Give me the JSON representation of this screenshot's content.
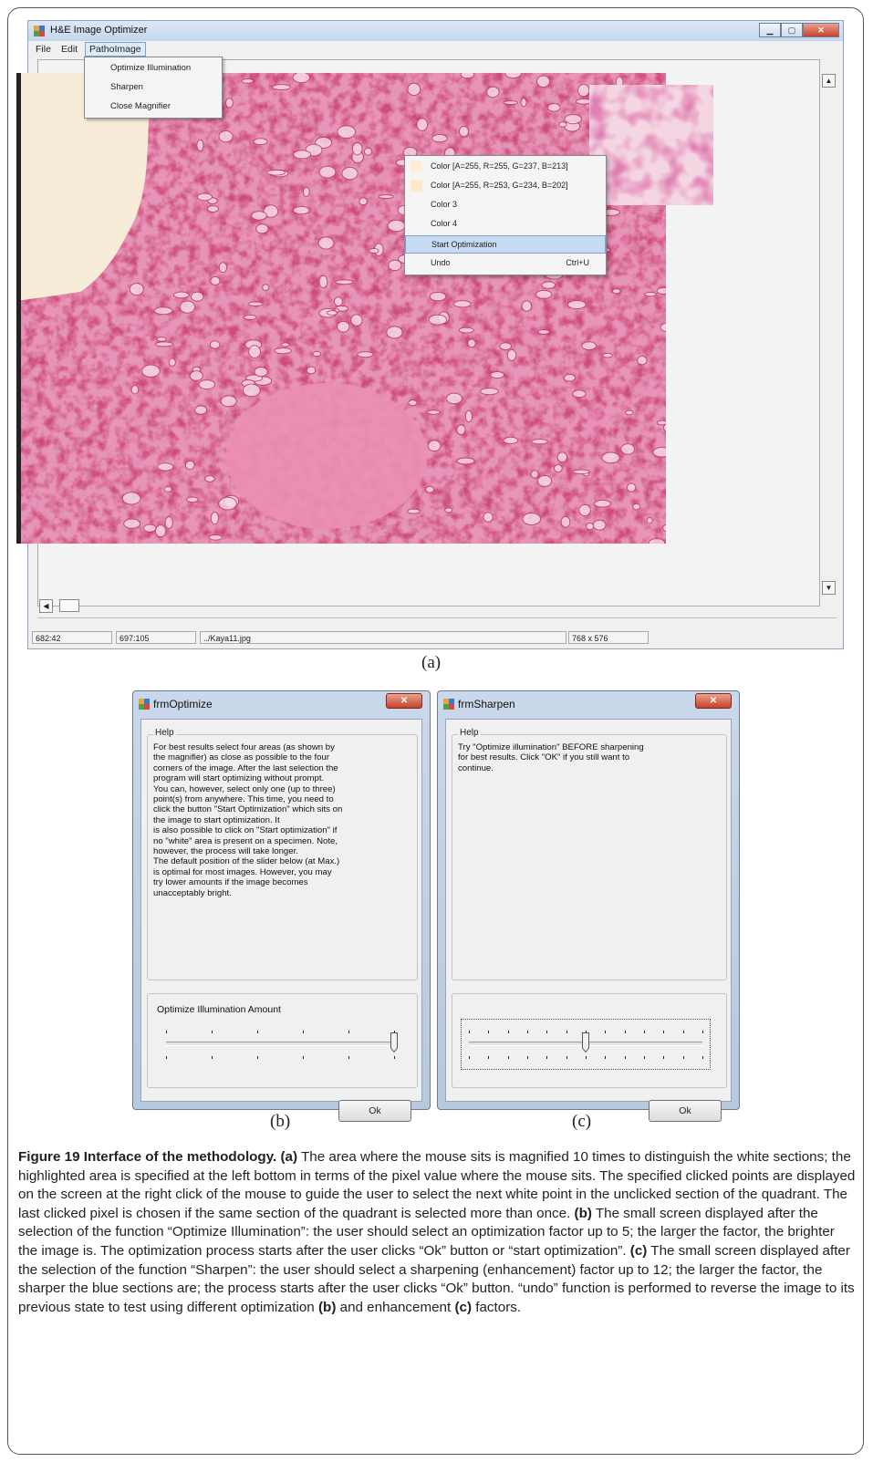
{
  "main_window": {
    "title": "H&E Image Optimizer",
    "menu": [
      "File",
      "Edit",
      "PathoImage"
    ],
    "patho_menu": [
      "Optimize Illumination",
      "Sharpen",
      "Close Magnifier"
    ],
    "context_menu": [
      {
        "label": "Color [A=255, R=255, G=237, B=213]",
        "swatch": "#ffedd5"
      },
      {
        "label": "Color [A=255, R=253, G=234, B=202]",
        "swatch": "#fdeaca"
      },
      {
        "label": "Color 3",
        "swatch": ""
      },
      {
        "label": "Color 4",
        "swatch": ""
      },
      {
        "label": "Start Optimization",
        "swatch": "",
        "highlighted": true
      },
      {
        "label": "Undo",
        "shortcut": "Ctrl+U"
      }
    ],
    "status": [
      "682:42",
      "697:105",
      "../Kaya11.jpg",
      "768 x 576"
    ],
    "window_buttons": [
      "minimize",
      "maximize",
      "close"
    ]
  },
  "labels": {
    "a": "(a)",
    "b": "(b)",
    "c": "(c)"
  },
  "dialog_optimize": {
    "title": "frmOptimize",
    "group_label": "Help",
    "help_text": "For best results select four areas (as shown by\nthe magnifier) as close as possible to the four\ncorners of the image.  After the last selection the\nprogram will start optimizing without prompt.\nYou can, however,  select only one (up to three)\npoint(s) from anywhere. This time, you need to\nclick the button \"Start Optimization\" which sits on\nthe image to start optimization.                      It\nis also possible to click on \"Start optimization\" if\nno \"white\" area is present on a specimen. Note,\nhowever, the process will take longer.\nThe default position of the slider below (at Max.)\nis optimal for most images.  However, you may\ntry lower amounts if the image becomes\nunacceptably bright.",
    "slider_label": "Optimize Illumination Amount",
    "slider_value": 5,
    "slider_max": 5,
    "ok_label": "Ok"
  },
  "dialog_sharpen": {
    "title": "frmSharpen",
    "group_label": "Help",
    "help_text": "Try \"Optimize illumination\" BEFORE sharpening\nfor best results.  Click \"OK\" if you still want to\ncontinue.",
    "slider_value": 6,
    "slider_max": 12,
    "ok_label": "Ok"
  },
  "caption": {
    "fig_label": "Figure 19 Interface of the methodology.",
    "a_mark": "(a)",
    "a_text": "The area where the mouse sits is magnified 10 times to distinguish the white sections; the highlighted area is specified at the left bottom in terms of the pixel value where the mouse sits. The specified clicked points are displayed on the screen at the right click of the mouse to guide the user to select the next white point in the unclicked section of the quadrant. The last clicked pixel is chosen if the same section of the quadrant is selected more than once.",
    "b_mark": "(b)",
    "b_text": "The small screen displayed after the selection of the function “Optimize Illumination”: the user should select an optimization factor up to 5; the larger the factor, the brighter the image is. The optimization process starts after the user clicks “Ok” button or “start optimization”.",
    "c_mark": "(c)",
    "c_text": "The small screen displayed after the selection of the function “Sharpen”: the user should select a sharpening (enhancement) factor up to 12; the larger the factor, the sharper the blue sections are; the process starts after the user clicks “Ok” button. “undo” function is performed to reverse the image to its previous state to test using different optimization",
    "b_mark2": "(b)",
    "and_text": "and enhancement",
    "c_mark2": "(c)",
    "end_text": "factors."
  },
  "colors": {
    "tissue_pink": "#e05a8f",
    "tissue_light": "#f2c3d3",
    "paper_bg": "#f7ecd8",
    "highlight": "#c7dbf2"
  }
}
